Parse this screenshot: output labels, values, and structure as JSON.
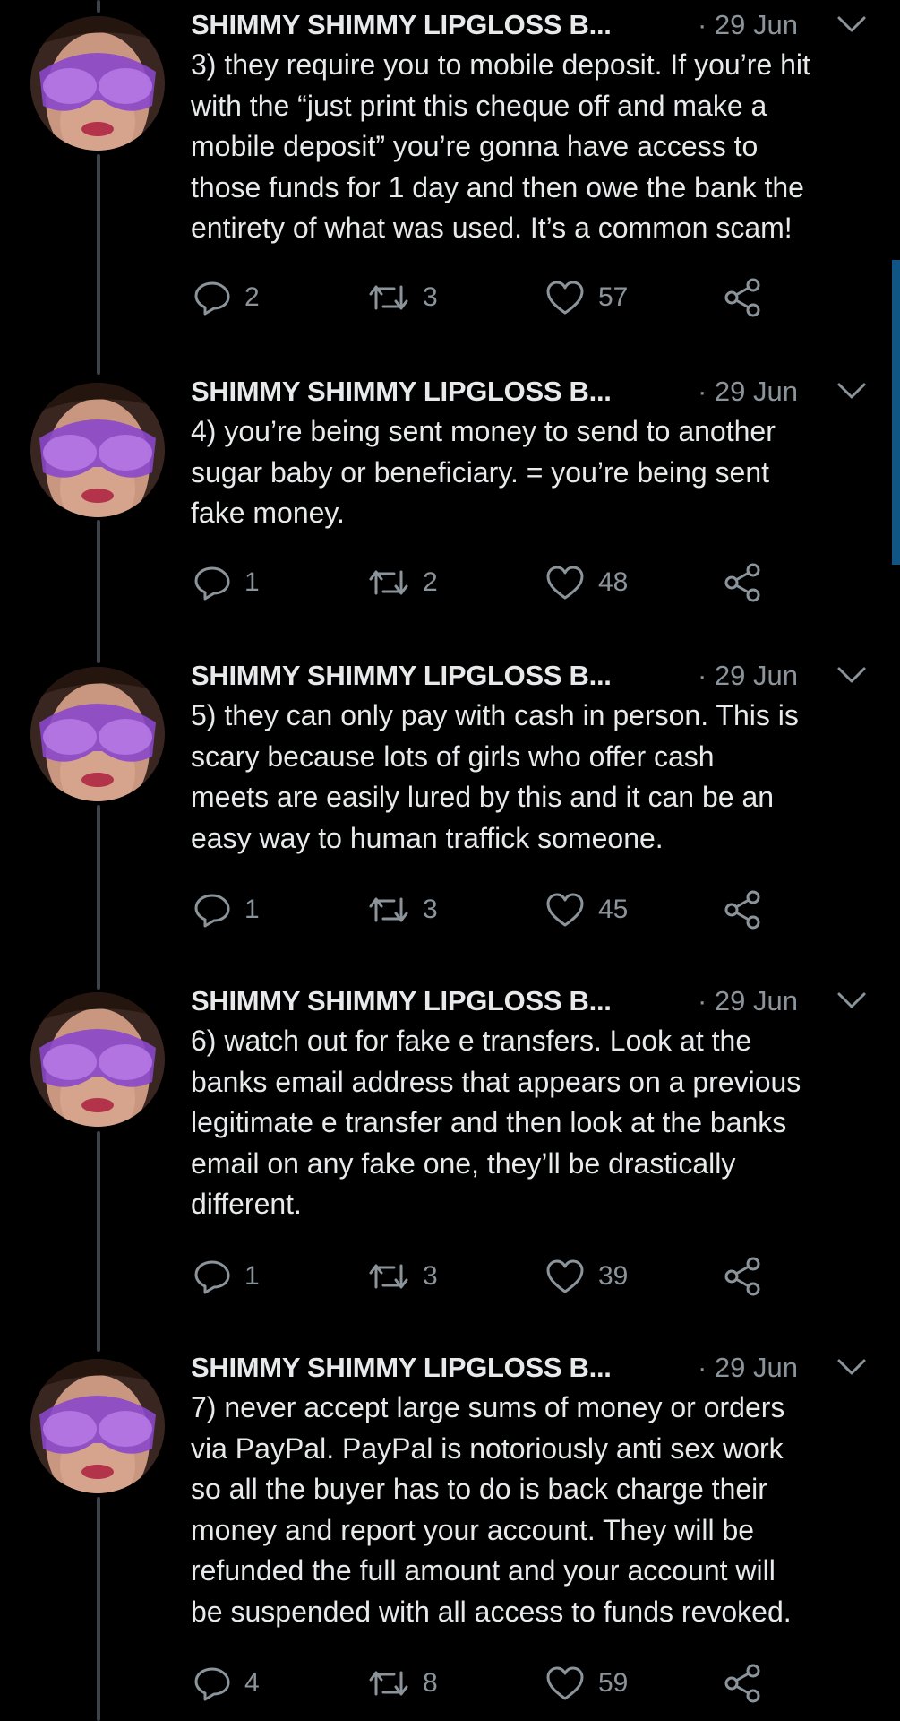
{
  "colors": {
    "background": "#000000",
    "text": "#e7e9ea",
    "muted": "#8b949a",
    "thread_line": "#3d4349",
    "scroll_indicator": "#1d9bf0"
  },
  "icons": {
    "reply": "reply-icon",
    "retweet": "retweet-icon",
    "like": "heart-icon",
    "share": "share-icon",
    "menu": "chevron-down-icon"
  },
  "tweets": [
    {
      "author": "SHIMMY SHIMMY LIPGLOSS B...",
      "date": "· 29 Jun",
      "text": "3) they require you to mobile deposit. If you’re hit\nwith the “just print this cheque off and make a\nmobile deposit” you’re gonna have access to\nthose funds for 1 day and then owe the bank the\nentirety of what was used. It’s a common scam!",
      "replies": "2",
      "retweets": "3",
      "likes": "57"
    },
    {
      "author": "SHIMMY SHIMMY LIPGLOSS B...",
      "date": "· 29 Jun",
      "text": "4) you’re being sent money to send to another\nsugar baby or beneficiary. = you’re being sent\nfake money.",
      "replies": "1",
      "retweets": "2",
      "likes": "48"
    },
    {
      "author": "SHIMMY SHIMMY LIPGLOSS B...",
      "date": "· 29 Jun",
      "text": "5) they can only pay with cash in person. This is\nscary because lots of girls who offer cash\nmeets are easily lured by this and it can be an\neasy way to human traffick someone.",
      "replies": "1",
      "retweets": "3",
      "likes": "45"
    },
    {
      "author": "SHIMMY SHIMMY LIPGLOSS B...",
      "date": "· 29 Jun",
      "text": "6) watch out for fake e transfers. Look at the\nbanks email address that appears on a previous\nlegitimate e transfer and then look at the banks\nemail on any fake one, they’ll be drastically\ndifferent.",
      "replies": "1",
      "retweets": "3",
      "likes": "39"
    },
    {
      "author": "SHIMMY SHIMMY LIPGLOSS B...",
      "date": "· 29 Jun",
      "text": "7) never accept large sums of money or orders\nvia PayPal. PayPal is notoriously anti sex work\nso all the buyer has to do is back charge their\nmoney and report your account. They will be\nrefunded the full amount and your account will\nbe suspended with all access to funds revoked.",
      "replies": "4",
      "retweets": "8",
      "likes": "59"
    }
  ]
}
